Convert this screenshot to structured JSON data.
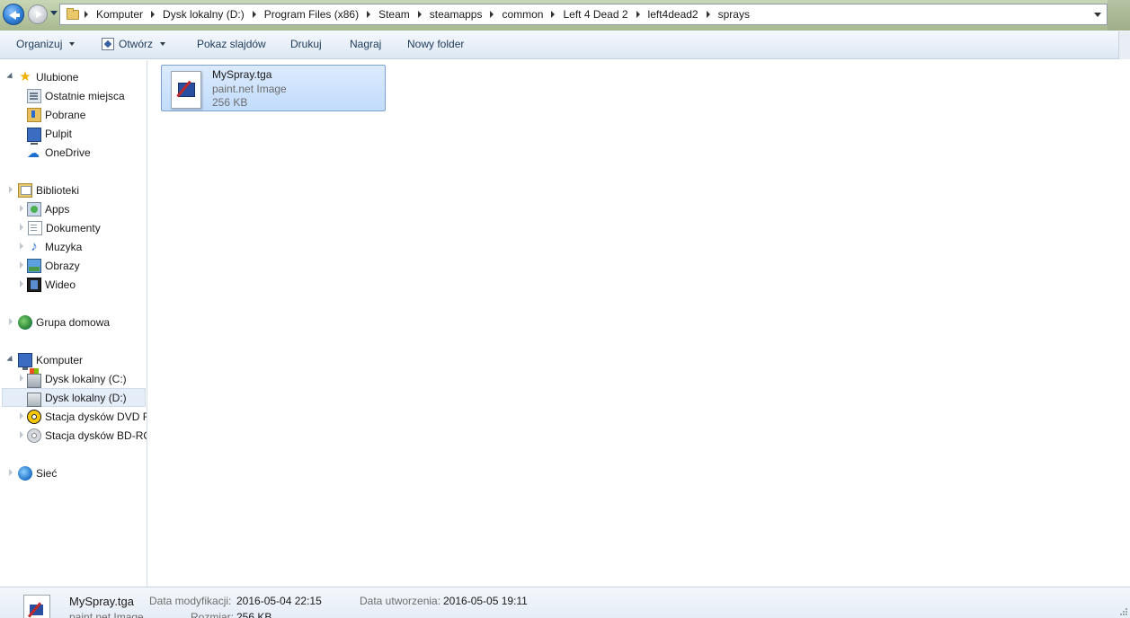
{
  "breadcrumbs": [
    "Komputer",
    "Dysk lokalny (D:)",
    "Program Files (x86)",
    "Steam",
    "steamapps",
    "common",
    "Left 4 Dead 2",
    "left4dead2",
    "sprays"
  ],
  "toolbar": {
    "organize": "Organizuj",
    "open": "Otwórz",
    "slideshow": "Pokaz slajdów",
    "print": "Drukuj",
    "burn": "Nagraj",
    "new_folder": "Nowy folder"
  },
  "nav": {
    "favorites": "Ulubione",
    "recent": "Ostatnie miejsca",
    "downloads": "Pobrane",
    "desktop": "Pulpit",
    "onedrive": "OneDrive",
    "libraries": "Biblioteki",
    "apps": "Apps",
    "documents": "Dokumenty",
    "music": "Muzyka",
    "pictures": "Obrazy",
    "videos": "Wideo",
    "homegroup": "Grupa domowa",
    "computer": "Komputer",
    "drive_c": "Dysk lokalny (C:)",
    "drive_d": "Dysk lokalny (D:)",
    "dvd": "Stacja dysków DVD RW",
    "bd": "Stacja dysków BD-ROM",
    "network": "Sieć"
  },
  "file": {
    "name": "MySpray.tga",
    "type": "paint.net Image",
    "size": "256 KB"
  },
  "details": {
    "name": "MySpray.tga",
    "type": "paint.net Image",
    "modified_label": "Data modyfikacji:",
    "modified_value": "2016-05-04 22:15",
    "created_label": "Data utworzenia:",
    "created_value": "2016-05-05 19:11",
    "size_label": "Rozmiar:",
    "size_value": "256 KB"
  }
}
